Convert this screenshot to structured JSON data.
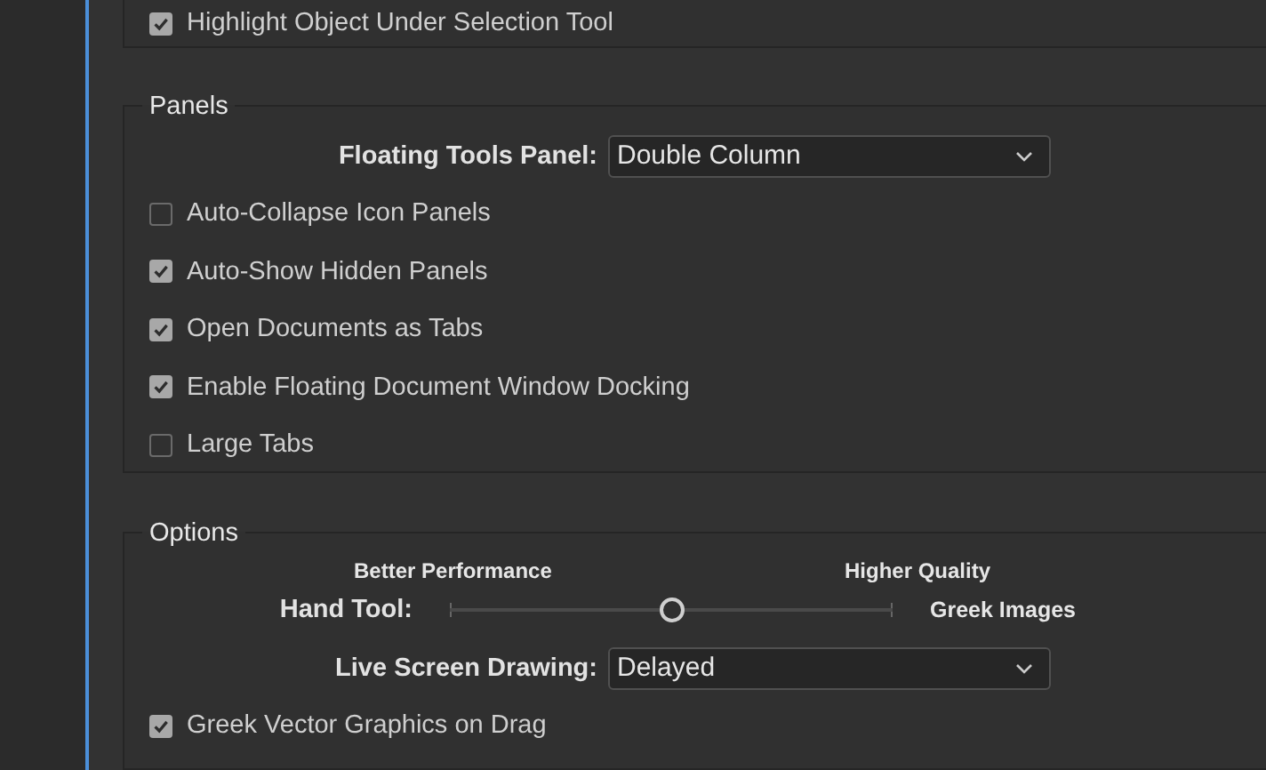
{
  "top_section": {
    "checkboxes": [
      {
        "label": "Highlight Object Under Selection Tool",
        "checked": true
      }
    ]
  },
  "panels": {
    "title": "Panels",
    "dropdown": {
      "label": "Floating Tools Panel:",
      "value": "Double Column"
    },
    "checkboxes": [
      {
        "label": "Auto-Collapse Icon Panels",
        "checked": false
      },
      {
        "label": "Auto-Show Hidden Panels",
        "checked": true
      },
      {
        "label": "Open Documents as Tabs",
        "checked": true
      },
      {
        "label": "Enable Floating Document Window Docking",
        "checked": true
      },
      {
        "label": "Large Tabs",
        "checked": false
      }
    ]
  },
  "options": {
    "title": "Options",
    "hand_tool": {
      "label": "Hand Tool:",
      "min_label": "Better Performance",
      "max_label": "Higher Quality",
      "level": 0.5,
      "end_label": "Greek Images"
    },
    "dropdown": {
      "label": "Live Screen Drawing:",
      "value": "Delayed"
    },
    "checkboxes": [
      {
        "label": "Greek Vector Graphics on Drag",
        "checked": true
      }
    ]
  }
}
